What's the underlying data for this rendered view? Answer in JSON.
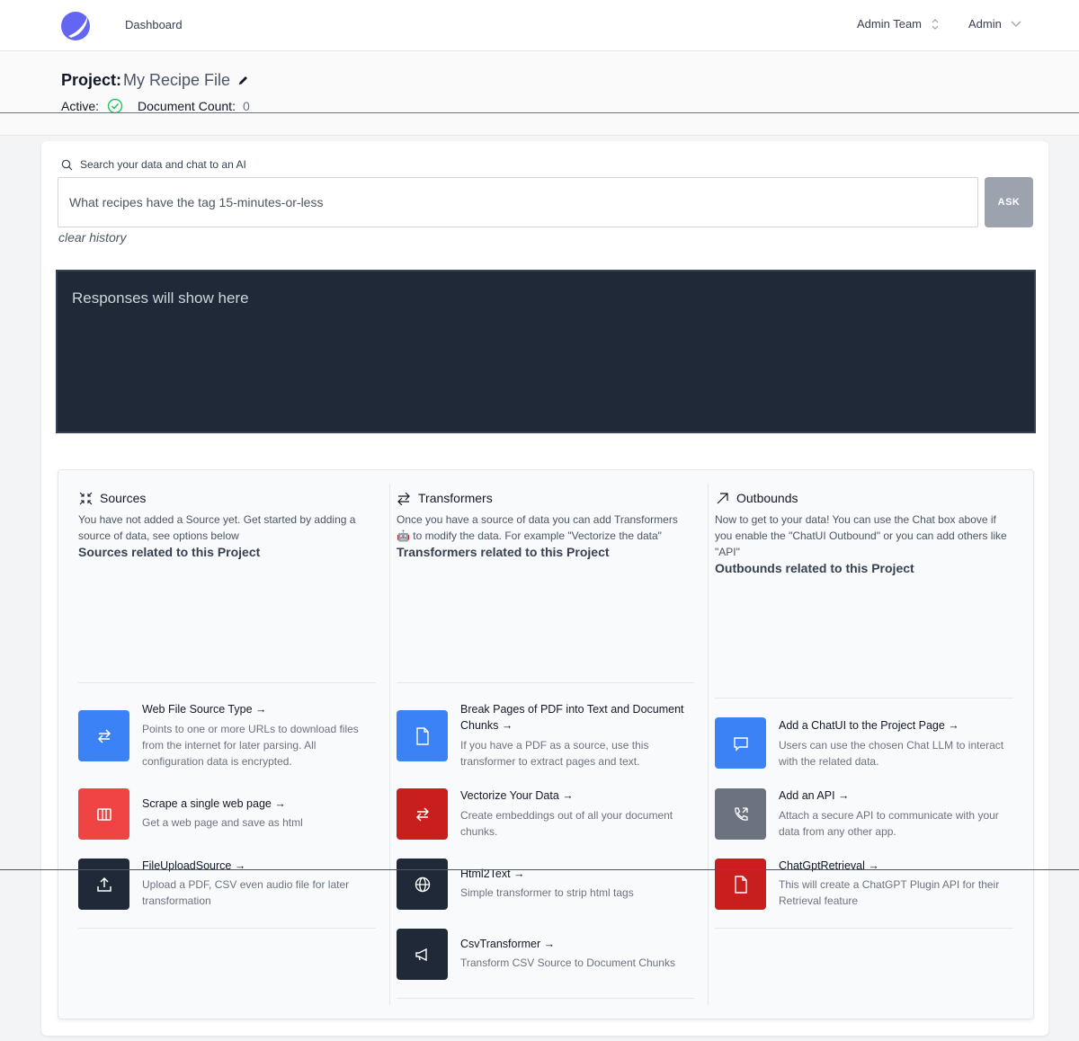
{
  "nav": {
    "dashboard_label": "Dashboard",
    "team_label": "Admin Team",
    "user_label": "Admin"
  },
  "project": {
    "title_label": "Project:",
    "name": "My Recipe File",
    "active_label": "Active:",
    "doc_count_label": "Document Count:",
    "doc_count": "0"
  },
  "search": {
    "label": "Search your data and chat to an AI",
    "value": "What recipes have the tag 15-minutes-or-less",
    "ask_label": "ASK",
    "clear_label": "clear history"
  },
  "response": {
    "placeholder": "Responses will show here"
  },
  "sources": {
    "title": "Sources",
    "description": "You have not added a Source yet. Get started by adding a source of data, see options below",
    "subtitle": "Sources related to this Project",
    "items": [
      {
        "title": "Web File Source Type →",
        "desc": "Points to one or more URLs to download files from the internet for later parsing. All configuration data is encrypted.",
        "icon": "arrows-icon"
      },
      {
        "title": "Scrape a single web page →",
        "desc": "Get a web page and save as html",
        "icon": "columns-icon"
      },
      {
        "title": "FileUploadSource →",
        "desc": "Upload a PDF, CSV even audio file for later transformation",
        "icon": "upload-icon"
      }
    ]
  },
  "transformers": {
    "title": "Transformers",
    "description": "Once you have a source of data you can add Transformers 🤖 to modify the data. For example \"Vectorize the data\"",
    "subtitle": "Transformers related to this Project",
    "items": [
      {
        "title": "Break Pages of PDF into Text and Document Chunks →",
        "desc": "If you have a PDF as a source, use this transformer to extract pages and text.",
        "icon": "document-icon"
      },
      {
        "title": "Vectorize Your Data →",
        "desc": "Create embeddings out of all your document chunks.",
        "icon": "arrows-icon"
      },
      {
        "title": "Html2Text →",
        "desc": "Simple transformer to strip html tags",
        "icon": "globe-icon"
      },
      {
        "title": "CsvTransformer →",
        "desc": "Transform CSV Source to Document Chunks",
        "icon": "megaphone-icon"
      }
    ]
  },
  "outbounds": {
    "title": "Outbounds",
    "description": "Now to get to your data! You can use the Chat box above if you enable the \"ChatUI Outbound\" or you can add others like \"API\"",
    "subtitle": "Outbounds related to this Project",
    "items": [
      {
        "title": "Add a ChatUI to the Project Page →",
        "desc": "Users can use the chosen Chat LLM to interact with the related data.",
        "icon": "chat-icon"
      },
      {
        "title": "Add an API →",
        "desc": "Attach a secure API to communicate with your data from any other app.",
        "icon": "phone-icon"
      },
      {
        "title": "ChatGptRetrieval →",
        "desc": "This will create a ChatGPT Plugin API for their Retrieval feature",
        "icon": "document-icon"
      }
    ]
  },
  "colors": {
    "blue": "#3b82f6",
    "red": "#ef4444",
    "dark_red": "#c81e1e",
    "navy": "#1f2937",
    "gray": "#6b7280",
    "active_green": "#22c55e"
  }
}
